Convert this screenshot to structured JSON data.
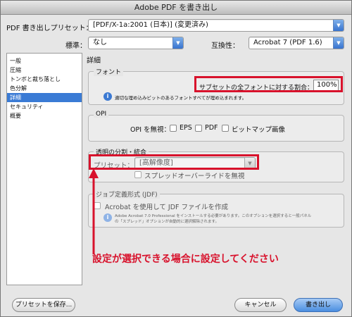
{
  "window": {
    "title": "Adobe PDF を書き出し"
  },
  "header": {
    "preset_label": "PDF 書き出しプリセット：",
    "preset_value": "[PDF/X-1a:2001 (日本)] (変更済み)",
    "standard_label": "標準：",
    "standard_value": "なし",
    "compat_label": "互換性：",
    "compat_value": "Acrobat 7 (PDF 1.6)"
  },
  "sidebar": {
    "items": [
      {
        "label": "一般"
      },
      {
        "label": "圧縮"
      },
      {
        "label": "トンボと裁ち落とし"
      },
      {
        "label": "色分解"
      },
      {
        "label": "詳細"
      },
      {
        "label": "セキュリティ"
      },
      {
        "label": "概要"
      }
    ],
    "selected_index": 4
  },
  "main": {
    "section_title": "詳細",
    "font": {
      "title": "フォント",
      "subset_label": "サブセットの全フォントに対する割合：",
      "subset_value": "100%",
      "note": "適切な埋め込みビットのあるフォントすべてが埋め込まれます。"
    },
    "opi": {
      "title": "OPI",
      "ignore_label": "OPI を無視：",
      "eps": "EPS",
      "pdf": "PDF",
      "bitmap": "ビットマップ画像"
    },
    "flatten": {
      "title": "透明の分割・統合",
      "preset_label": "プリセット：",
      "preset_value": "[高解像度]",
      "spread_override": "スプレッドオーバーライドを無視"
    },
    "jdf": {
      "title": "ジョブ定義形式 (JDF)",
      "create_label": "Acrobat を使用して JDF ファイルを作成",
      "note_line1": "Adobe Acrobat 7.0 Professional をインストールする必要があります。このオプションを選択すると一般パネル",
      "note_line2": "の「スプレッド」オプションが自動的に選択解除されます。"
    }
  },
  "annotation": {
    "text": "設定が選択できる場合に設定してください"
  },
  "footer": {
    "save_preset": "プリセットを保存...",
    "cancel": "キャンセル",
    "export": "書き出し"
  },
  "colors": {
    "annotation_red": "#d8122c",
    "selection_blue": "#3a7bd5"
  }
}
